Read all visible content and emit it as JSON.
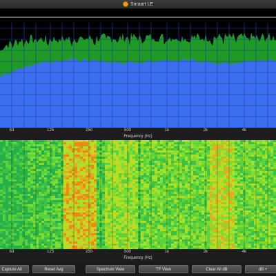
{
  "window": {
    "title": "Smaart LE",
    "app_icon": "orange-circle"
  },
  "spectrum_view": {
    "xlabel": "Frequency (Hz)",
    "ticks": [
      "63",
      "125",
      "250",
      "500",
      "1k",
      "2k",
      "4k"
    ],
    "colors": {
      "fill_blue": "#3b6ff0",
      "fill_green": "#1f9a25",
      "grid": "#1f3fa0"
    }
  },
  "spectrograph_view": {
    "xlabel": "Frequency (Hz)",
    "ticks": [
      "63",
      "125",
      "250",
      "500",
      "1k",
      "2k",
      "4k"
    ]
  },
  "toolbar": {
    "buttons": [
      "Capture All",
      "Reset Avg",
      "Spectrum View",
      "TF View",
      "Clear All dB",
      "dB +"
    ]
  }
}
